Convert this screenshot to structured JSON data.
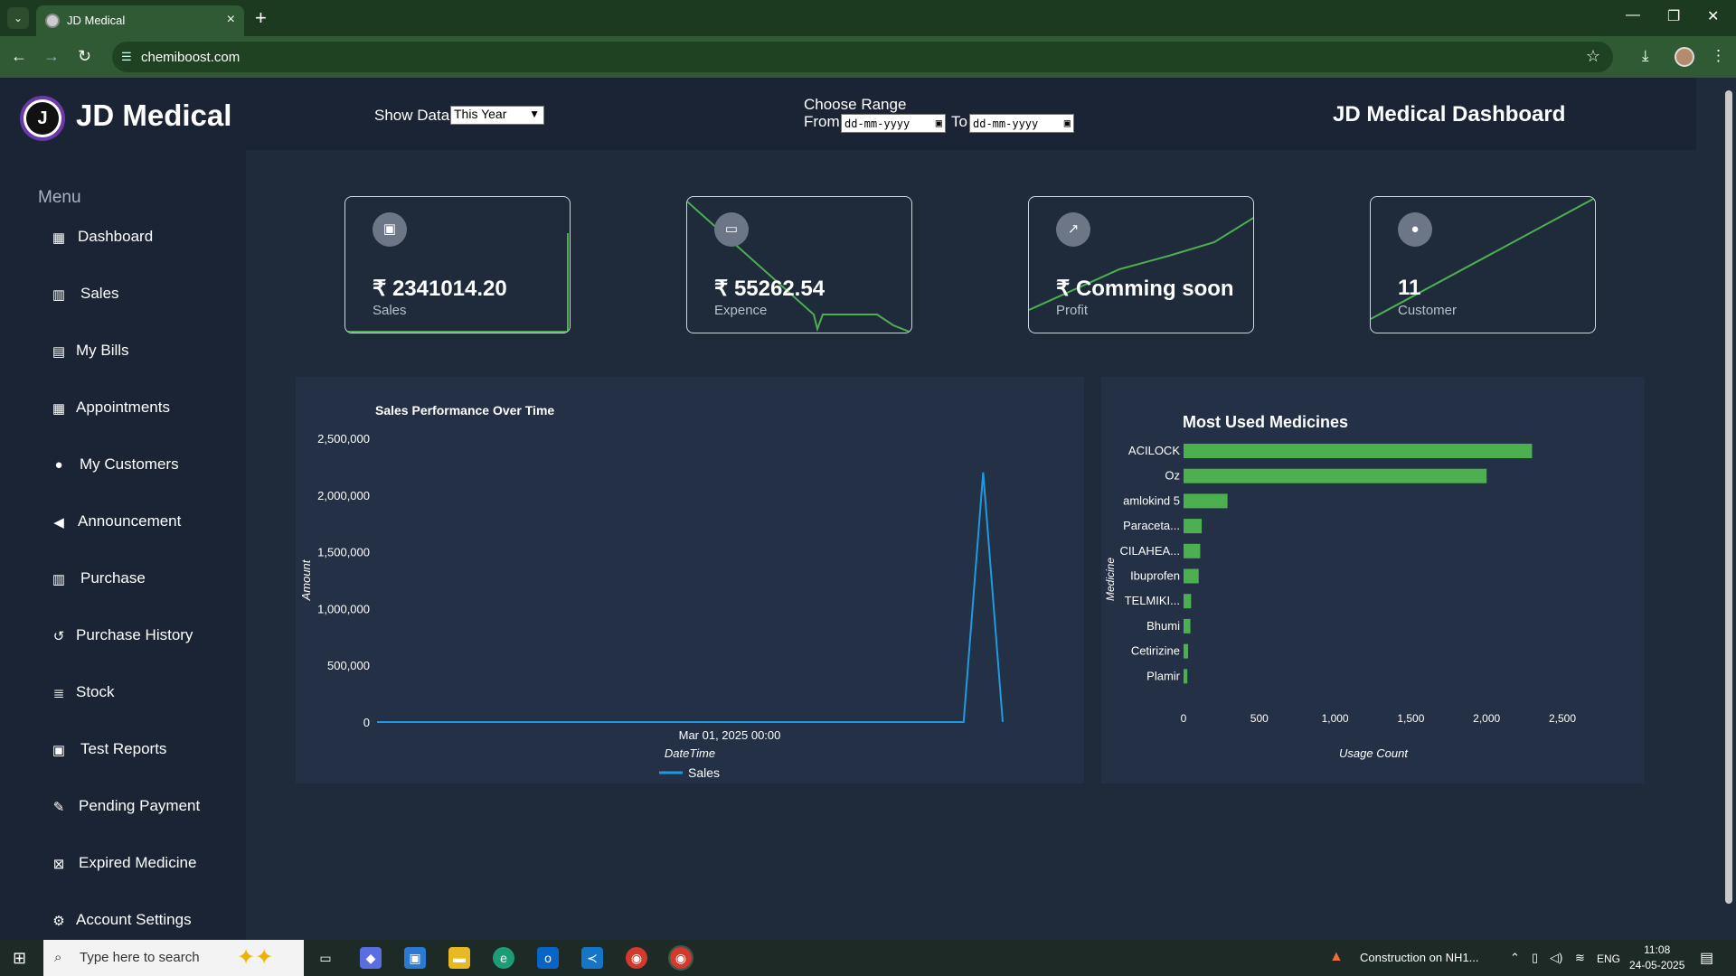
{
  "browser": {
    "tab_title": "JD Medical",
    "url": "chemiboost.com"
  },
  "header": {
    "brand": "JD Medical",
    "logo_text": "J",
    "show_data_label": "Show Data",
    "show_data_value": "This Year",
    "range_title": "Choose Range",
    "from_label": "From",
    "from_placeholder": "dd-mm-yyyy",
    "to_label": "To",
    "to_placeholder": "dd-mm-yyyy",
    "dashboard_title": "JD Medical Dashboard"
  },
  "sidebar": {
    "heading": "Menu",
    "items": [
      {
        "label": "Dashboard",
        "icon": "grid-icon"
      },
      {
        "label": "Sales",
        "icon": "bar-chart-icon"
      },
      {
        "label": "My Bills",
        "icon": "file-icon"
      },
      {
        "label": "Appointments",
        "icon": "calendar-icon"
      },
      {
        "label": "My Customers",
        "icon": "users-icon"
      },
      {
        "label": "Announcement",
        "icon": "megaphone-icon"
      },
      {
        "label": "Purchase",
        "icon": "bank-icon"
      },
      {
        "label": "Purchase History",
        "icon": "history-icon"
      },
      {
        "label": "Stock",
        "icon": "database-icon"
      },
      {
        "label": "Test Reports",
        "icon": "id-card-icon"
      },
      {
        "label": "Pending Payment",
        "icon": "edit-icon"
      },
      {
        "label": "Expired Medicine",
        "icon": "calendar-x-icon"
      },
      {
        "label": "Account Settings",
        "icon": "gear-icon"
      }
    ]
  },
  "cards": [
    {
      "value": "₹ 2341014.20",
      "label": "Sales",
      "icon": "money-icon"
    },
    {
      "value": "₹ 55262.54",
      "label": "Expence",
      "icon": "credit-card-icon"
    },
    {
      "value": "₹ Comming soon",
      "label": "Profit",
      "icon": "trend-icon"
    },
    {
      "value": "11",
      "label": "Customer",
      "icon": "users-icon"
    }
  ],
  "colors": {
    "accent_green": "#4caf50",
    "line_blue": "#1e9be0",
    "panel_bg": "#243045",
    "sidebar_bg": "#1b2434"
  },
  "chart_data": [
    {
      "type": "line",
      "title": "Sales Performance Over Time",
      "xlabel": "DateTime",
      "ylabel": "Amount",
      "x_tick_labels": [
        "Mar 01, 2025 00:00"
      ],
      "y_ticks": [
        "0",
        "500,000",
        "1,000,000",
        "1,500,000",
        "2,000,000",
        "2,500,000"
      ],
      "ylim": [
        0,
        2500000
      ],
      "series": [
        {
          "name": "Sales",
          "values": [
            0,
            0,
            0,
            0,
            0,
            0,
            0,
            0,
            0,
            0,
            0,
            0,
            0,
            0,
            0,
            0,
            0,
            0,
            0,
            0,
            0,
            0,
            0,
            0,
            0,
            0,
            0,
            0,
            0,
            0,
            0,
            2200000,
            0
          ]
        }
      ],
      "legend": "bottom"
    },
    {
      "type": "bar",
      "orientation": "horizontal",
      "title": "Most Used Medicines",
      "xlabel": "Usage Count",
      "ylabel": "Medicine",
      "categories": [
        "ACILOCK",
        "Oz",
        "amlokind 5",
        "Paraceta...",
        "CILAHEA...",
        "Ibuprofen",
        "TELMIKI...",
        "Bhumi",
        "Cetirizine",
        "Plamir"
      ],
      "values": [
        2300,
        2000,
        290,
        120,
        110,
        100,
        50,
        45,
        30,
        25
      ],
      "x_ticks": [
        "0",
        "500",
        "1,000",
        "1,500",
        "2,000",
        "2,500"
      ],
      "xlim": [
        0,
        2500
      ]
    }
  ],
  "taskbar": {
    "search_placeholder": "Type here to search",
    "news": "Construction on NH1...",
    "lang": "ENG",
    "time": "11:08",
    "date": "24-05-2025"
  }
}
